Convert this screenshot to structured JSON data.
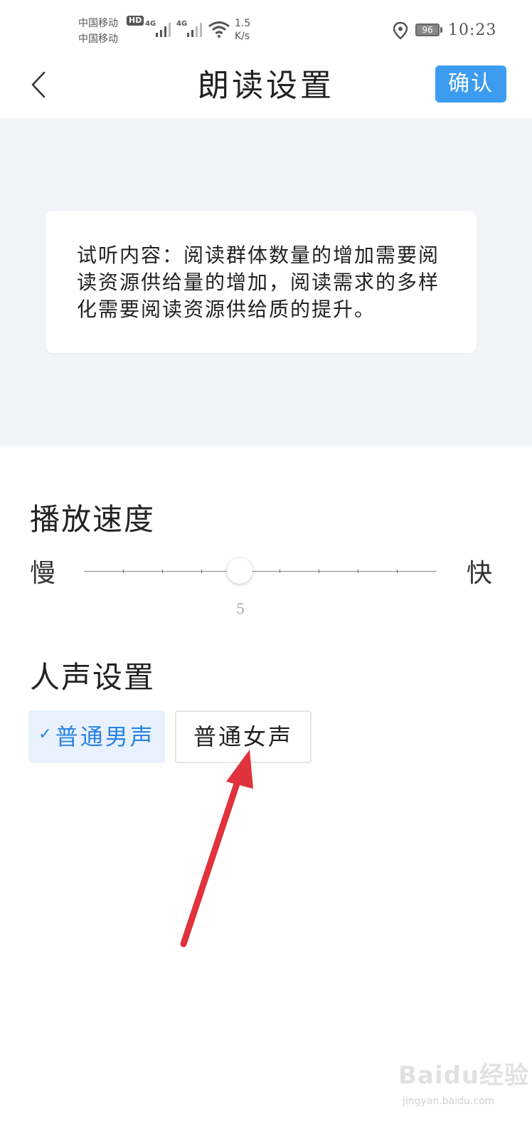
{
  "status_bar": {
    "carrier_1": "中国移动",
    "carrier_2": "中国移动",
    "hd_badge": "HD",
    "network_1": "4G",
    "network_2": "4G",
    "speed_value": "1.5",
    "speed_unit": "K/s",
    "battery_level": "96",
    "time": "10:23",
    "icons": [
      "signal-icon",
      "wifi-icon",
      "location-icon",
      "battery-icon"
    ]
  },
  "header": {
    "title": "朗读设置",
    "confirm_label": "确认",
    "back_icon": "chevron-left-icon"
  },
  "preview": {
    "text": "试听内容：阅读群体数量的增加需要阅读资源供给量的增加，阅读需求的多样化需要阅读资源供给质的提升。"
  },
  "speed": {
    "title": "播放速度",
    "slow_label": "慢",
    "fast_label": "快",
    "value": "5",
    "min": 1,
    "max": 10
  },
  "voice": {
    "title": "人声设置",
    "options": [
      {
        "label": "普通男声",
        "selected": true
      },
      {
        "label": "普通女声",
        "selected": false
      }
    ],
    "check_icon": "✓"
  },
  "watermark": {
    "logo": "Baidu经验",
    "url": "jingyan.baidu.com"
  },
  "colors": {
    "accent": "#3d9bf0",
    "selected_bg": "#e8f1fd",
    "selected_text": "#2b83e3",
    "preview_bg": "#f2f4f8",
    "annotation_arrow": "#e0323c"
  }
}
